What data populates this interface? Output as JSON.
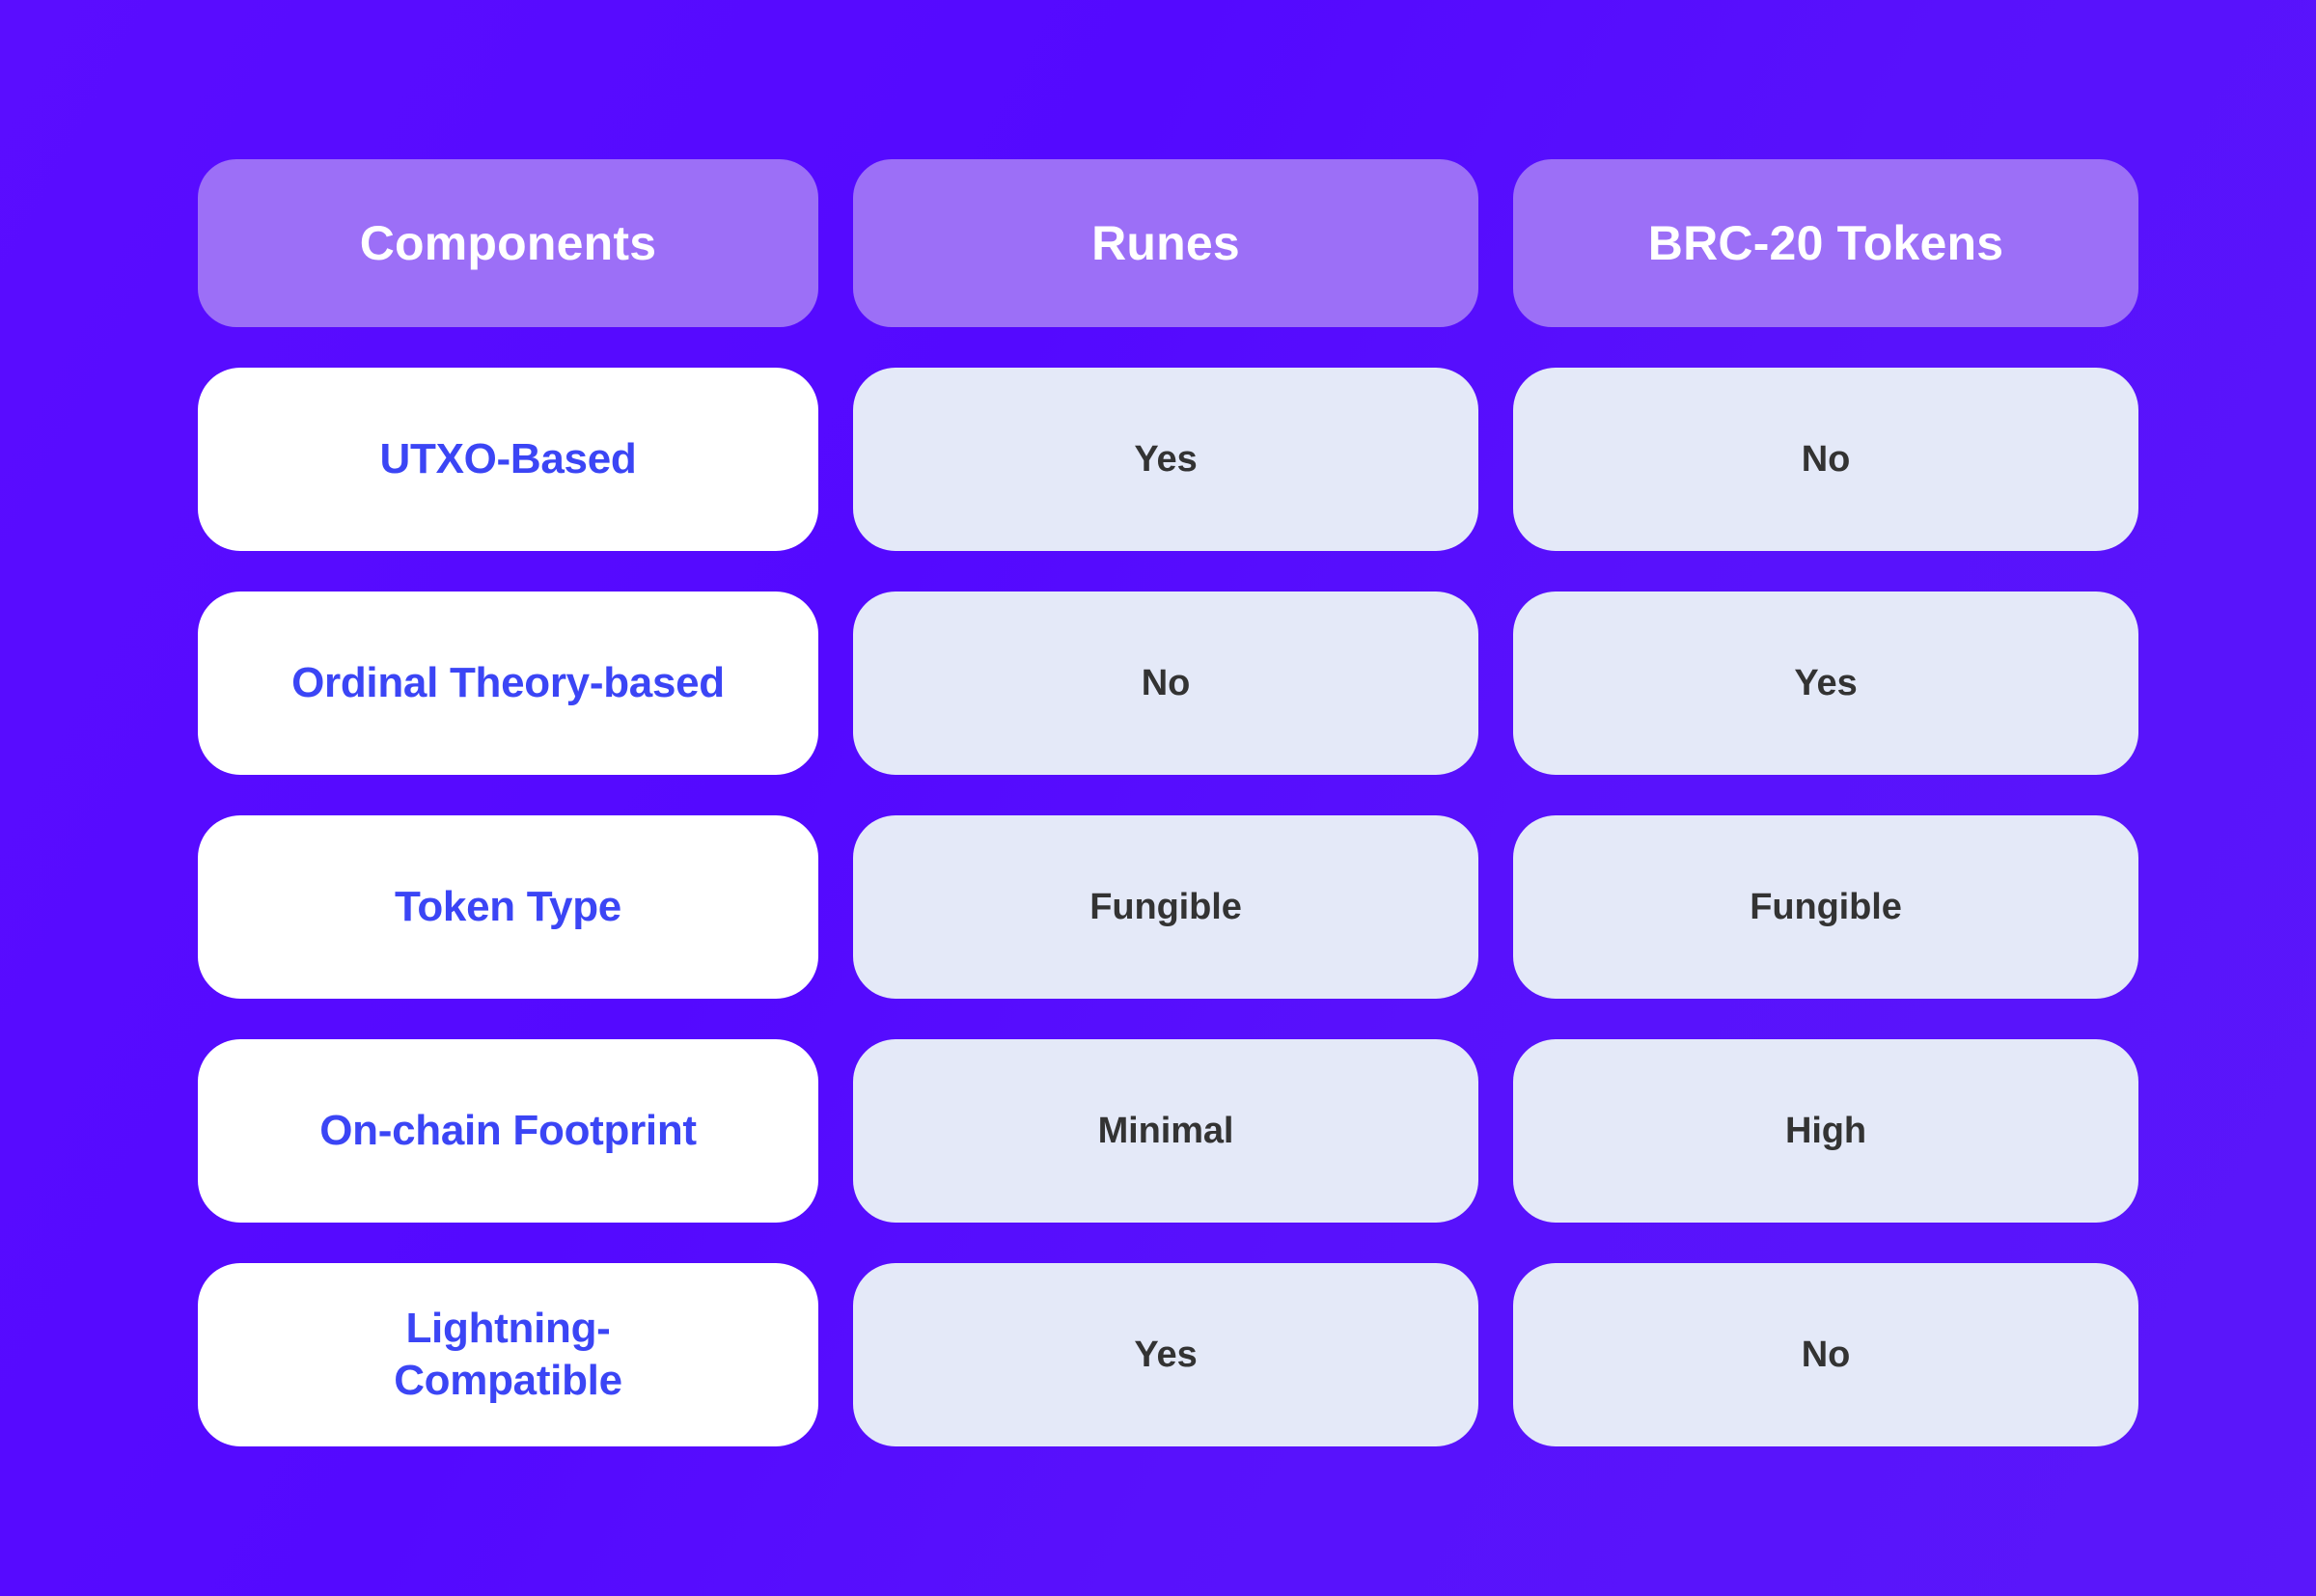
{
  "table": {
    "headers": [
      {
        "label": "Components",
        "name": "components"
      },
      {
        "label": "Runes",
        "name": "runes"
      },
      {
        "label": "BRC-20 Tokens",
        "name": "brc20-tokens"
      }
    ],
    "rows": [
      {
        "label": "UTXO-Based",
        "runes": "Yes",
        "brc20": "No"
      },
      {
        "label": "Ordinal Theory-based",
        "runes": "No",
        "brc20": "Yes"
      },
      {
        "label": "Token Type",
        "runes": "Fungible",
        "brc20": "Fungible"
      },
      {
        "label": "On-chain Footprint",
        "runes": "Minimal",
        "brc20": "High"
      },
      {
        "label": "Lightning-Compatible",
        "runes": "Yes",
        "brc20": "No"
      }
    ]
  },
  "colors": {
    "background_start": "#5a0dff",
    "background_end": "#5a17fa",
    "header_cell": "#9c6ff7",
    "header_text": "#ffffff",
    "label_cell": "#ffffff",
    "label_text": "#3b45f5",
    "value_cell": "#e4e9f8",
    "value_text": "#333333"
  }
}
